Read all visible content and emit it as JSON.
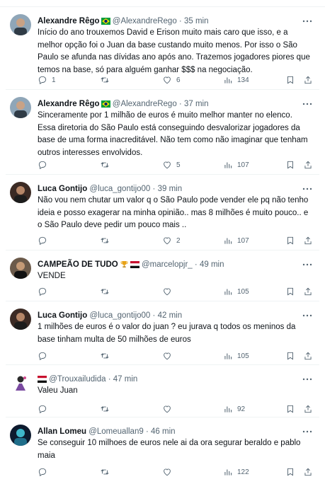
{
  "posts": [
    {
      "name": "Alexandre Rêgo",
      "handle": "@AlexandreRego",
      "time": "35 min",
      "text": "Início do ano trouxemos David e Erison muito mais caro que isso, e a melhor opção foi o Juan da base custando muito menos. Por isso o São Paulo se afunda nas dívidas ano após ano. Trazemos jogadores piores que temos na base, só para alguém ganhar $$$ na negociação.",
      "replies": "1",
      "retweets": "",
      "likes": "6",
      "views": "134"
    },
    {
      "name": "Alexandre Rêgo",
      "handle": "@AlexandreRego",
      "time": "37 min",
      "text": "Sinceramente por 1 milhão de euros é muito melhor manter no elenco. Essa diretoria do São Paulo está conseguindo desvalorizar jogadores da base de uma forma inacreditável. Não tem como não imaginar que tenham outros interesses envolvidos.",
      "replies": "",
      "retweets": "",
      "likes": "5",
      "views": "107"
    },
    {
      "name": "Luca Gontijo",
      "handle": "@luca_gontijo00",
      "time": "39 min",
      "text": "Não vou nem chutar um valor q o São Paulo pode vender ele pq não tenho ideia  e posso exagerar na minha opinião.. mas 8 milhões é muito pouco.. e o São Paulo deve pedir um pouco mais ..",
      "replies": "",
      "retweets": "",
      "likes": "2",
      "views": "107"
    },
    {
      "name": "CAMPEÃO DE TUDO",
      "handle": "@marcelopjr_",
      "time": "49 min",
      "text": "VENDE",
      "replies": "",
      "retweets": "",
      "likes": "",
      "views": "105"
    },
    {
      "name": "Luca Gontijo",
      "handle": "@luca_gontijo00",
      "time": "42 min",
      "text": "1 milhões de euros é o valor do juan ? eu jurava q todos os meninos da base tinham multa de 50 milhões de euros",
      "replies": "",
      "retweets": "",
      "likes": "",
      "views": "105"
    },
    {
      "name": "",
      "handle": "@Trouxailudida",
      "time": "47 min",
      "text": "Valeu Juan",
      "replies": "",
      "retweets": "",
      "likes": "",
      "views": "92"
    },
    {
      "name": "Allan Lomeu",
      "handle": "@Lomeuallan9",
      "time": "46 min",
      "text": "Se conseguir 10 milhoes de euros nele ai da ora segurar beraldo e pablo maia",
      "replies": "",
      "retweets": "",
      "likes": "",
      "views": "122"
    }
  ],
  "separator": "·",
  "colors": {
    "text": "#0f1419",
    "muted": "#536471",
    "border": "#eff3f4",
    "brazil_green": "#009c3b",
    "brazil_yellow": "#ffdf00",
    "brazil_blue": "#002776",
    "trophy_gold": "#e8a317",
    "spfc_red": "#c8102e"
  },
  "icons": {
    "reply": "reply-icon",
    "retweet": "retweet-icon",
    "like": "like-icon",
    "views": "views-icon",
    "bookmark": "bookmark-icon",
    "share": "share-icon",
    "more": "more-icon",
    "brazil_flag": "brazil-flag-icon",
    "trophy": "trophy-icon",
    "spfc_flag": "spfc-flag-icon"
  }
}
